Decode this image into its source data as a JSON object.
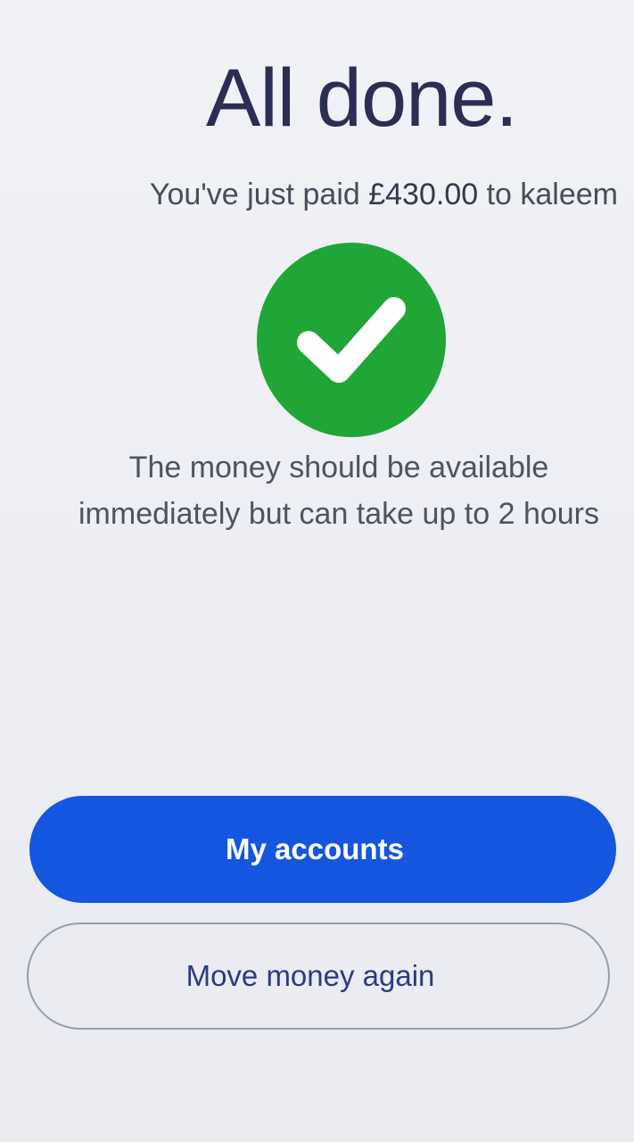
{
  "confirmation": {
    "title": "All done.",
    "paid_prefix": "You've just paid ",
    "amount": "£430.00",
    "paid_suffix": " to kaleem",
    "status_icon": "check-circle-icon",
    "info_line1": "The money should be available",
    "info_line2": "immediately but can take up to 2 hours"
  },
  "actions": {
    "primary_label": "My accounts",
    "secondary_label": "Move money again"
  },
  "colors": {
    "success": "#1fa637",
    "primary_button": "#1556e0",
    "title": "#2b2d55",
    "secondary_text": "#2c3a86"
  }
}
